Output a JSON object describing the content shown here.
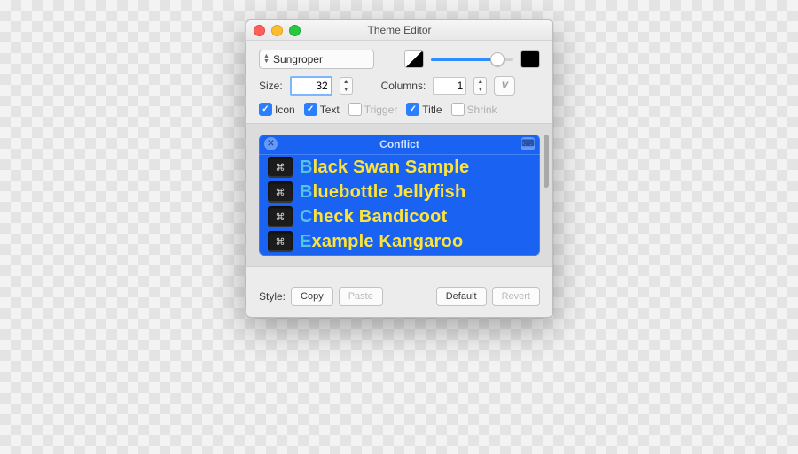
{
  "window": {
    "title": "Theme Editor"
  },
  "theme": {
    "name": "Sungroper"
  },
  "size": {
    "label": "Size:",
    "value": "32"
  },
  "columns": {
    "label": "Columns:",
    "value": "1"
  },
  "checks": {
    "icon": {
      "label": "Icon",
      "checked": true
    },
    "text": {
      "label": "Text",
      "checked": true
    },
    "trigger": {
      "label": "Trigger",
      "checked": false
    },
    "title": {
      "label": "Title",
      "checked": true
    },
    "shrink": {
      "label": "Shrink",
      "checked": false
    }
  },
  "preview": {
    "title": "Conflict",
    "items": [
      "Black Swan Sample",
      "Bluebottle Jellyfish",
      "Check Bandicoot",
      "Example Kangaroo"
    ]
  },
  "footer": {
    "style_label": "Style:",
    "copy": "Copy",
    "paste": "Paste",
    "default": "Default",
    "revert": "Revert"
  },
  "icons": {
    "close": "✕",
    "gear": "⌘",
    "arrange": "↯"
  }
}
